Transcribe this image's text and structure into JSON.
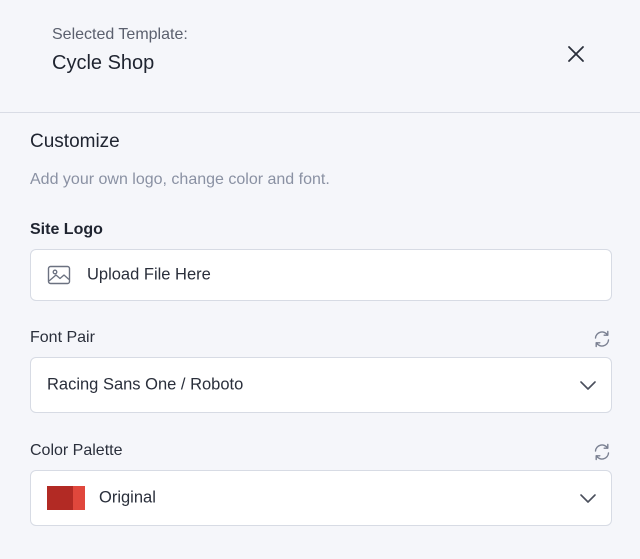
{
  "header": {
    "subtitle": "Selected Template:",
    "template_name": "Cycle Shop"
  },
  "customize": {
    "title": "Customize",
    "description": "Add your own logo, change color and font."
  },
  "site_logo": {
    "label": "Site Logo",
    "placeholder": "Upload File Here"
  },
  "font_pair": {
    "label": "Font Pair",
    "value": "Racing Sans One / Roboto"
  },
  "color_palette": {
    "label": "Color Palette",
    "value": "Original",
    "swatch_colors": [
      "#b22a24",
      "#e0473c"
    ]
  },
  "icons": {
    "close": "close-icon",
    "image": "image-icon",
    "refresh": "refresh-icon",
    "chevron": "chevron-down-icon"
  }
}
